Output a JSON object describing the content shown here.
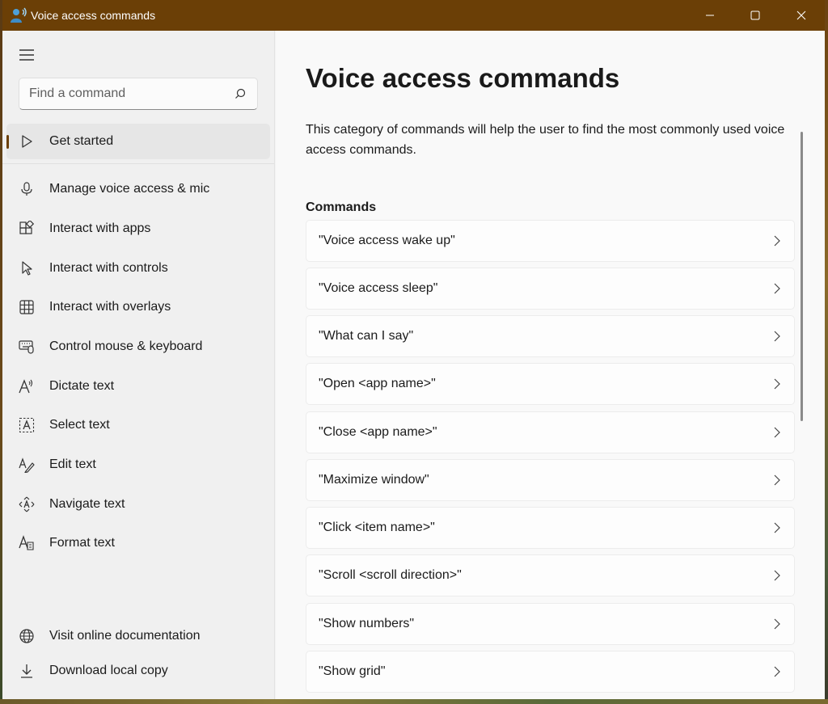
{
  "window": {
    "title": "Voice access commands",
    "accent": "#6b3f06"
  },
  "sidebar": {
    "search": {
      "placeholder": "Find a command",
      "value": ""
    },
    "items": [
      {
        "label": "Get started",
        "icon": "play-icon",
        "selected": true
      },
      {
        "label": "Manage voice access & mic",
        "icon": "microphone-icon"
      },
      {
        "label": "Interact with apps",
        "icon": "apps-icon"
      },
      {
        "label": "Interact with controls",
        "icon": "cursor-icon"
      },
      {
        "label": "Interact with overlays",
        "icon": "grid-icon"
      },
      {
        "label": "Control mouse & keyboard",
        "icon": "keyboard-mouse-icon"
      },
      {
        "label": "Dictate text",
        "icon": "dictate-icon"
      },
      {
        "label": "Select text",
        "icon": "select-text-icon"
      },
      {
        "label": "Edit text",
        "icon": "edit-text-icon"
      },
      {
        "label": "Navigate text",
        "icon": "navigate-text-icon"
      },
      {
        "label": "Format text",
        "icon": "format-text-icon"
      }
    ],
    "footer": [
      {
        "label": "Visit online documentation",
        "icon": "globe-icon"
      },
      {
        "label": "Download local copy",
        "icon": "download-icon"
      }
    ]
  },
  "main": {
    "title": "Voice access commands",
    "description": "This category of commands will help the user to find the most commonly used voice access commands.",
    "section_title": "Commands",
    "commands": [
      "\"Voice access wake up\"",
      "\"Voice access sleep\"",
      "\"What can I say\"",
      "\"Open <app name>\"",
      "\"Close <app name>\"",
      "\"Maximize window\"",
      "\"Click <item name>\"",
      "\"Scroll <scroll direction>\"",
      "\"Show numbers\"",
      "\"Show grid\""
    ]
  }
}
